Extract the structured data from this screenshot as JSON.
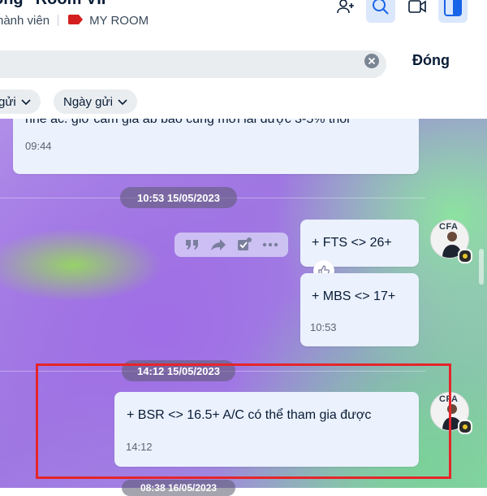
{
  "header": {
    "title": "ông \"Room VIP",
    "member_label": "hành viên",
    "tag_label": "MY ROOM",
    "tag_color": "#d31f1f",
    "accent": "#1864e8",
    "icons": [
      "add-member-icon",
      "search-icon",
      "video-call-icon",
      "sidebar-toggle-icon"
    ]
  },
  "search": {
    "value": "",
    "placeholder": "",
    "close_label": "Đóng"
  },
  "filters": [
    {
      "label": "gửi"
    },
    {
      "label": "Ngày gửi"
    }
  ],
  "messages": {
    "first": {
      "text": "nhé ac. giờ cầm giá ab bảo cũng mới lãi được 3-5% thôi",
      "time": "09:44"
    },
    "divider1": "10:53 15/05/2023",
    "fts": {
      "text": "+ FTS <>  26+"
    },
    "mbs": {
      "text": "+ MBS <> 17+",
      "time": "10:53"
    },
    "divider2": "14:12 15/05/2023",
    "bsr": {
      "text": "+ BSR <> 16.5+ A/C có thể tham gia được",
      "time": "14:12"
    },
    "divider3": "08:38 16/05/2023"
  },
  "avatar": {
    "label": "CFA"
  },
  "highlight_color": "#e5252a"
}
